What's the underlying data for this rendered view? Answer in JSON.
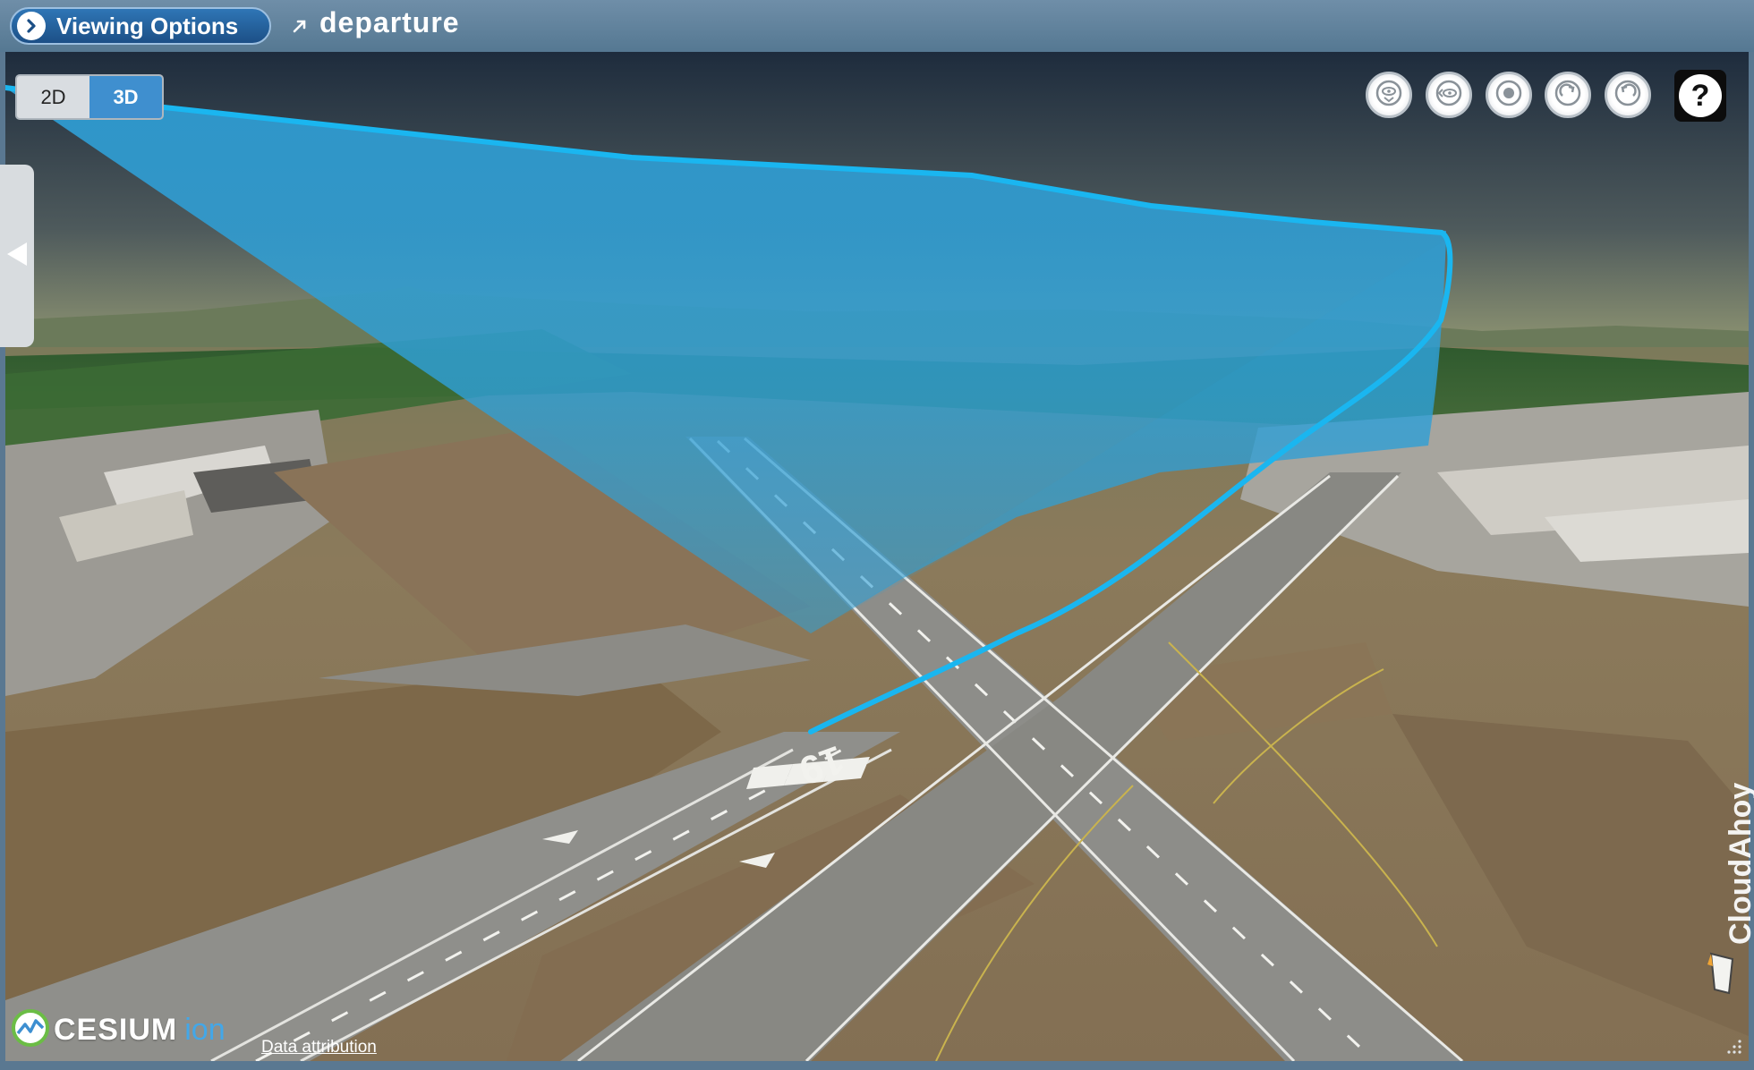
{
  "toolbar": {
    "viewing_options_label": "Viewing Options",
    "departure_title": "departure",
    "departure_icon": "arrow-up-right-icon"
  },
  "view_mode": {
    "options": [
      "2D",
      "3D"
    ],
    "selected": "3D"
  },
  "navigation_buttons": [
    {
      "name": "top-view-icon"
    },
    {
      "name": "side-view-icon"
    },
    {
      "name": "center-icon"
    },
    {
      "name": "rotate-right-icon"
    },
    {
      "name": "rotate-left-icon"
    }
  ],
  "help": {
    "label": "?"
  },
  "map": {
    "runway_number": "19",
    "flight_path_color": "#1ab6f0",
    "curtain_color": "#2f9fd6"
  },
  "credits": {
    "cesium_word": "CESIUM",
    "cesium_suffix": "ion",
    "data_attribution": "Data attribution",
    "brand": "CloudAhoy"
  }
}
